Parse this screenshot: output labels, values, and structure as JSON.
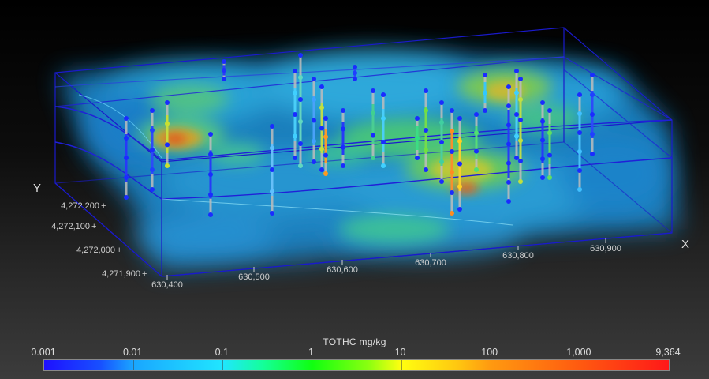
{
  "scene": {
    "y_axis_title": "Y",
    "x_axis_title": "X",
    "y_ticks": [
      "4,272,200",
      "4,272,100",
      "4,272,000",
      "4,271,900"
    ],
    "x_ticks": [
      "630,400",
      "630,500",
      "630,600",
      "630,700",
      "630,800",
      "630,900"
    ]
  },
  "legend": {
    "title": "TOTHC mg/kg",
    "ticks": [
      "0.001",
      "0.01",
      "0.1",
      "1",
      "10",
      "100",
      "1,000",
      "9,364"
    ]
  },
  "colors": {
    "box_edges": "#1a1acc",
    "background_top": "#000000",
    "background_bottom": "#3c3c3c",
    "scale_low": "#1e10ff",
    "scale_mid": "#10ff10",
    "scale_high": "#ff1818"
  }
}
